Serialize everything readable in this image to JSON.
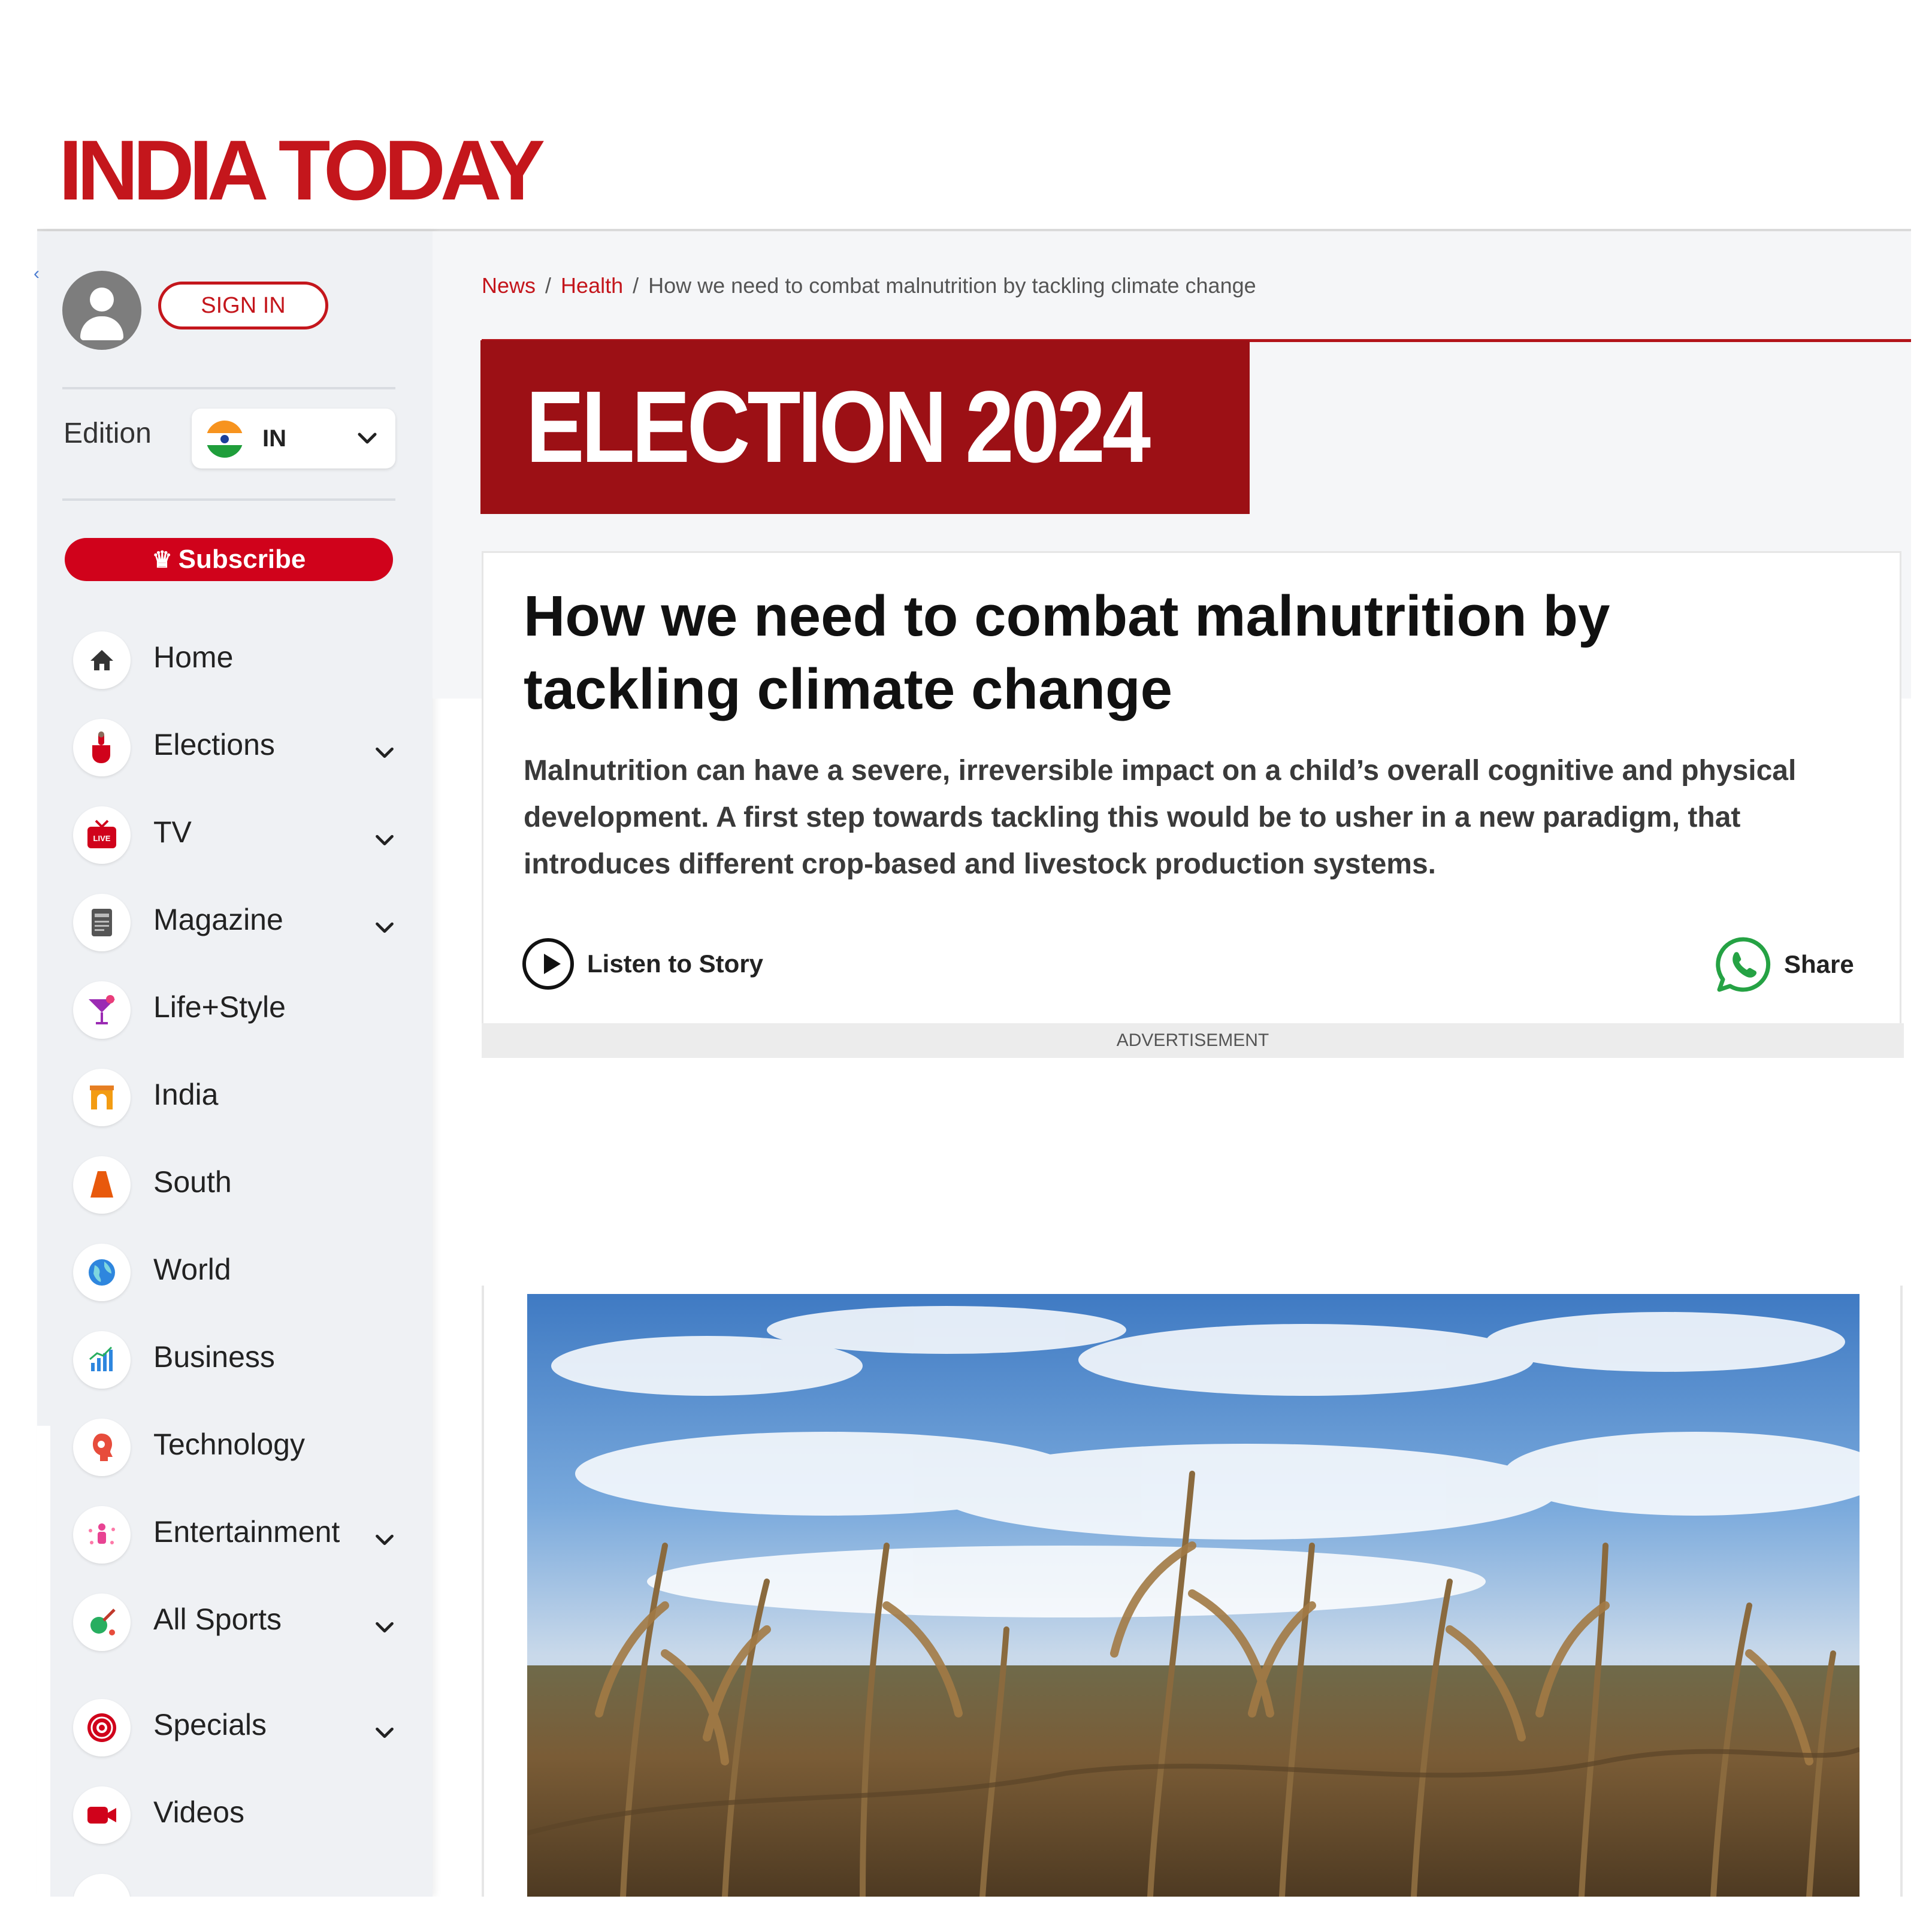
{
  "logo": {
    "text": "INDIA TODAY"
  },
  "user": {
    "sign_in_label": "SIGN IN"
  },
  "edition": {
    "label": "Edition",
    "code": "IN"
  },
  "subscribe": {
    "label": "Subscribe"
  },
  "nav": [
    {
      "label": "Home",
      "icon": "home-icon",
      "has_submenu": false
    },
    {
      "label": "Elections",
      "icon": "vote-hand-icon",
      "has_submenu": true
    },
    {
      "label": "TV",
      "icon": "live-tv-icon",
      "has_submenu": true
    },
    {
      "label": "Magazine",
      "icon": "magazine-icon",
      "has_submenu": true
    },
    {
      "label": "Life+Style",
      "icon": "cocktail-icon",
      "has_submenu": false
    },
    {
      "label": "India",
      "icon": "india-gate-icon",
      "has_submenu": false
    },
    {
      "label": "South",
      "icon": "south-temple-icon",
      "has_submenu": false
    },
    {
      "label": "World",
      "icon": "globe-icon",
      "has_submenu": false
    },
    {
      "label": "Business",
      "icon": "bar-chart-icon",
      "has_submenu": false
    },
    {
      "label": "Technology",
      "icon": "tech-head-icon",
      "has_submenu": false
    },
    {
      "label": "Entertainment",
      "icon": "entertainment-icon",
      "has_submenu": true
    },
    {
      "label": "All Sports",
      "icon": "sports-icon",
      "has_submenu": true
    },
    {
      "label": "Specials",
      "icon": "specials-icon",
      "has_submenu": true
    },
    {
      "label": "Videos",
      "icon": "video-icon",
      "has_submenu": false
    }
  ],
  "breadcrumb": {
    "items": [
      "News",
      "Health",
      "How we need to combat malnutrition by tackling climate change"
    ]
  },
  "banner": {
    "text": "ELECTION 2024"
  },
  "article": {
    "headline": "How we need to combat malnutrition by tackling climate change",
    "summary": "Malnutrition can have a severe, irreversible impact on a child’s overall cognitive and physical development. A first step towards tackling this would be to usher in a new paradigm, that introduces different crop-based and livestock production systems.",
    "listen_label": "Listen to Story",
    "share_label": "Share",
    "ad_label": "ADVERTISEMENT"
  },
  "colors": {
    "brand_red": "#c4161c",
    "banner_red": "#9c1015",
    "whatsapp_green": "#25a244"
  }
}
